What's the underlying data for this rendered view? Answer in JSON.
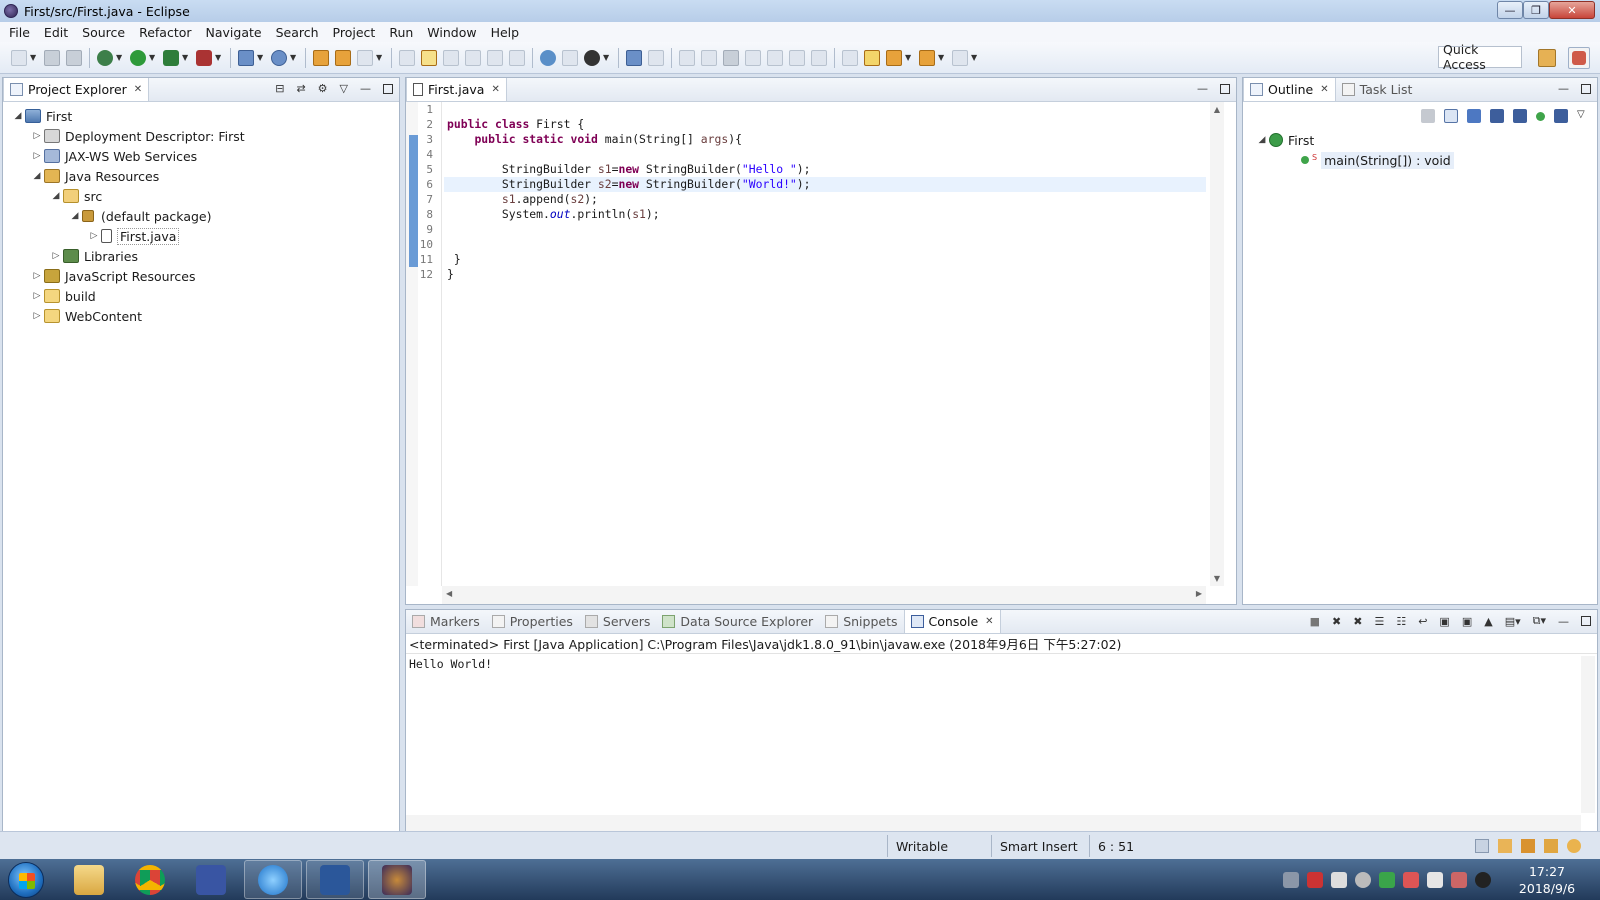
{
  "window": {
    "title": "First/src/First.java - Eclipse"
  },
  "menu": [
    "File",
    "Edit",
    "Source",
    "Refactor",
    "Navigate",
    "Search",
    "Project",
    "Run",
    "Window",
    "Help"
  ],
  "toolbar": {
    "quick_access": "Quick Access"
  },
  "project_explorer": {
    "tab_label": "Project Explorer",
    "tree": [
      {
        "label": "First",
        "expanded": true,
        "icon": "project-icon"
      },
      {
        "label": "Deployment Descriptor: First",
        "icon": "deployment-descriptor-icon"
      },
      {
        "label": "JAX-WS Web Services",
        "icon": "web-services-icon"
      },
      {
        "label": "Java Resources",
        "icon": "java-resources-icon"
      },
      {
        "label": "src",
        "icon": "source-folder-icon"
      },
      {
        "label": "(default package)",
        "icon": "package-icon"
      },
      {
        "label": "First.java",
        "icon": "java-file-icon"
      },
      {
        "label": "Libraries",
        "icon": "libraries-icon"
      },
      {
        "label": "JavaScript Resources",
        "icon": "javascript-resources-icon"
      },
      {
        "label": "build",
        "icon": "folder-icon"
      },
      {
        "label": "WebContent",
        "icon": "folder-icon"
      }
    ]
  },
  "editor": {
    "tab_label": "First.java",
    "line_numbers": [
      "1",
      "2",
      "3",
      "4",
      "5",
      "6",
      "7",
      "8",
      "9",
      "10",
      "11",
      "12"
    ],
    "current_line": 6,
    "code": {
      "l2_kw1": "public",
      "l2_kw2": "class",
      "l2_rest": " First {",
      "l3_kw1": "public",
      "l3_kw2": "static",
      "l3_kw3": "void",
      "l3_rest1": " main(String[] ",
      "l3_var": "args",
      "l3_rest2": "){",
      "l5_type": "StringBuilder ",
      "l5_var": "s1",
      "l5_eq": "=",
      "l5_kw": "new",
      "l5_call": " StringBuilder(",
      "l5_str": "\"Hello \"",
      "l5_end": ");",
      "l6_type": "StringBuilder ",
      "l6_var": "s2",
      "l6_eq": "=",
      "l6_kw": "new",
      "l6_call": " StringBuilder(",
      "l6_str": "\"World!\"",
      "l6_end": ");",
      "l7_var": "s1",
      "l7_call": ".append(",
      "l7_arg": "s2",
      "l7_end": ");",
      "l8_cls": "System.",
      "l8_fld": "out",
      "l8_call": ".println(",
      "l8_arg": "s1",
      "l8_end": ");",
      "l11": " }",
      "l12": "}"
    }
  },
  "outline": {
    "tab_label": "Outline",
    "task_tab_label": "Task List",
    "class_name": "First",
    "method": "main(String[]) : void",
    "method_modifier": "S"
  },
  "bottom_tabs": [
    "Markers",
    "Properties",
    "Servers",
    "Data Source Explorer",
    "Snippets",
    "Console"
  ],
  "console": {
    "header": "<terminated> First [Java Application] C:\\Program Files\\Java\\jdk1.8.0_91\\bin\\javaw.exe (2018年9月6日 下午5:27:02)",
    "output": "Hello World!"
  },
  "status": {
    "writable": "Writable",
    "insert_mode": "Smart Insert",
    "position": "6 : 51"
  },
  "taskbar": {
    "time": "17:27",
    "date": "2018/9/6"
  }
}
